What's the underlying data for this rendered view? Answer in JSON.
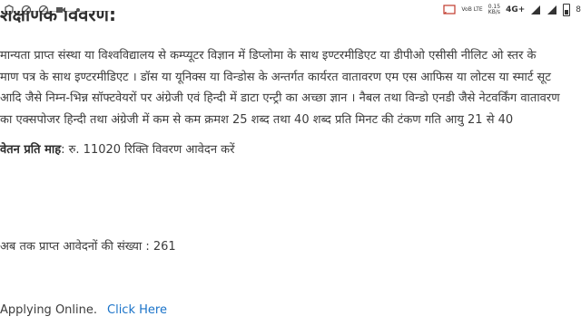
{
  "status_bar": {
    "volte": "VoB LTE",
    "speed_value": "0.15",
    "speed_unit": "KB/s",
    "network": "4G+",
    "battery": "8"
  },
  "page": {
    "heading": "शैक्षणिक विवरण:",
    "paragraph_lines": [
      "मान्यता प्राप्त संस्था या विश्वविद्यालय से कम्प्यूटर विज्ञान में डिप्लोमा के साथ इण्टरमीडिएट या डीपीओ एसीसी नीलिट ओ स्तर के",
      "माण पत्र के साथ इण्टरमीडिएट । डॉस या यूनिक्स या विन्डोस के अन्तर्गत कार्यरत वातावरण एम एस आफिस या लोटस या स्मार्ट सूट",
      "आदि जैसे निम्न-भिन्न सॉफ्टवेयरों पर अंग्रेजी एवं हिन्दी में डाटा एन्ट्री का अच्छा ज्ञान । नैबल तथा विन्डो एनडी जैसे नेटवर्किंग वातावरण",
      "का एक्सपोजर हिन्दी तथा अंग्रेजी में कम से कम क्रमश 25 शब्द तथा 40 शब्द प्रति मिनट की टंकण गति आयु 21 से 40"
    ],
    "salary_label": "वेतन प्रति माह",
    "salary_value": ": रु. 11020 रिक्ति विवरण आवेदन करें",
    "applications_count": "अब तक प्राप्त आवेदनों की संख्या : 261",
    "applying_text": "Applying Online.",
    "click_here": "Click Here"
  }
}
